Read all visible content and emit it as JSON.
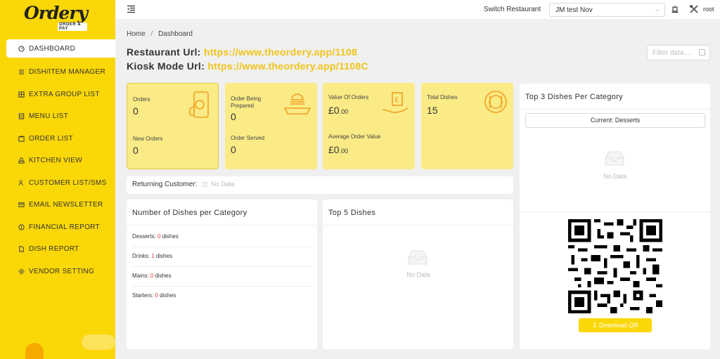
{
  "brand": {
    "name": "Ordery",
    "tagline": "ORDER & PAY"
  },
  "sidebar": {
    "items": [
      {
        "label": "DASHBOARD",
        "icon": "dashboard-icon",
        "active": true
      },
      {
        "label": "DISH/ITEM MANAGER",
        "icon": "list-icon"
      },
      {
        "label": "EXTRA GROUP LIST",
        "icon": "grid-icon"
      },
      {
        "label": "MENU LIST",
        "icon": "menu-icon"
      },
      {
        "label": "ORDER LIST",
        "icon": "order-icon"
      },
      {
        "label": "KITCHEN VIEW",
        "icon": "kitchen-icon"
      },
      {
        "label": "CUSTOMER LIST/SMS",
        "icon": "users-icon"
      },
      {
        "label": "EMAIL NEWSLETTER",
        "icon": "mail-icon"
      },
      {
        "label": "FINANCIAL REPORT",
        "icon": "finance-icon"
      },
      {
        "label": "DISH REPORT",
        "icon": "dish-report-icon"
      },
      {
        "label": "VENDOR SETTING",
        "icon": "gear-icon"
      }
    ]
  },
  "header": {
    "switch_label": "Switch Restaurant",
    "restaurant_selected": "JM test Nov",
    "user": "root"
  },
  "breadcrumb": {
    "home": "Home",
    "separator": "/",
    "current": "Dashboard"
  },
  "urls": {
    "restaurant_label": "Restaurant Url:",
    "restaurant_url": "https://www.theordery.app/1108",
    "kiosk_label": "Kiosk Mode Url:",
    "kiosk_url": "https://www.theordery.app/1108C"
  },
  "filter": {
    "placeholder": "Filter data ..."
  },
  "stats": {
    "orders": {
      "label": "Orders",
      "value": "0",
      "sub_label": "New Orders",
      "sub_value": "0"
    },
    "prepared": {
      "label": "Order Being Prepared",
      "value": "0",
      "sub_label": "Order Served",
      "sub_value": "0"
    },
    "value": {
      "label": "Value Of Orders",
      "currency": "£",
      "value": "0",
      "decimals": ".00",
      "sub_label": "Average Order Value",
      "sub_value": "0",
      "sub_decimals": ".00"
    },
    "dishes": {
      "label": "Total Dishes",
      "value": "15"
    }
  },
  "returning": {
    "label": "Returning Customer:",
    "value": "No Data"
  },
  "dishes_per_category": {
    "title": "Number of Dishes per Category",
    "unit": "dishes",
    "rows": [
      {
        "name": "Desserts",
        "count": "0"
      },
      {
        "name": "Drinks",
        "count": "1"
      },
      {
        "name": "Mains",
        "count": "0"
      },
      {
        "name": "Starters",
        "count": "0"
      }
    ]
  },
  "top5": {
    "title": "Top 5 Dishes",
    "empty": "No Data"
  },
  "top3": {
    "title": "Top 3 Dishes Per Category",
    "current": "Current: Desserts",
    "empty": "No Data",
    "download": "Download QR"
  },
  "colors": {
    "brand_yellow": "#fad707",
    "card_yellow": "#faeb86",
    "link_yellow": "#f0c419",
    "count_red": "#e53935"
  }
}
